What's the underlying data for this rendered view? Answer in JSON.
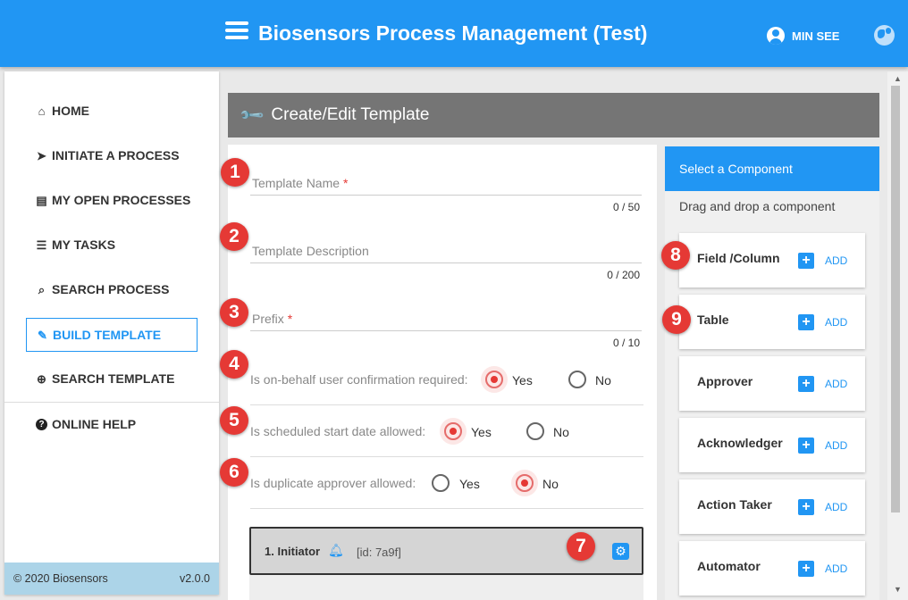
{
  "header": {
    "title": "Biosensors Process Management (Test)",
    "user": "MIN SEE",
    "colors": {
      "bar": "#2196f3"
    }
  },
  "sidebar": {
    "items": [
      {
        "label": "HOME",
        "icon": "home-icon",
        "glyph": "⌂"
      },
      {
        "label": "INITIATE A PROCESS",
        "icon": "chevron-icon",
        "glyph": "➤"
      },
      {
        "label": "MY OPEN PROCESSES",
        "icon": "document-icon",
        "glyph": "▤"
      },
      {
        "label": "MY TASKS",
        "icon": "list-icon",
        "glyph": "☰"
      },
      {
        "label": "SEARCH PROCESS",
        "icon": "search-icon",
        "glyph": "⌕"
      },
      {
        "label": "BUILD TEMPLATE",
        "icon": "wrench-icon",
        "glyph": "🔧",
        "active": true
      },
      {
        "label": "SEARCH TEMPLATE",
        "icon": "zoom-icon",
        "glyph": "⊕"
      },
      {
        "label": "ONLINE HELP",
        "icon": "help-icon",
        "glyph": "?"
      }
    ],
    "footer": {
      "copyright": "© 2020 Biosensors",
      "version": "v2.0.0"
    }
  },
  "main": {
    "title": "Create/Edit Template",
    "fields": [
      {
        "placeholder": "Template Name",
        "required": "*",
        "counter": "0 / 50"
      },
      {
        "placeholder": "Template Description",
        "required": "",
        "counter": "0 / 200"
      },
      {
        "placeholder": "Prefix",
        "required": "*",
        "counter": "0 / 10"
      }
    ],
    "questions": [
      {
        "label": "Is on-behalf user confirmation required:",
        "yes": "Yes",
        "no": "No",
        "selected": "yes"
      },
      {
        "label": "Is scheduled start date allowed:",
        "yes": "Yes",
        "no": "No",
        "selected": "yes"
      },
      {
        "label": "Is duplicate approver allowed:",
        "yes": "Yes",
        "no": "No",
        "selected": "no"
      }
    ],
    "initiator": {
      "title": "1. Initiator",
      "id": "[id: 7a9f]"
    },
    "badges": [
      "1",
      "2",
      "3",
      "4",
      "5",
      "6",
      "7",
      "8",
      "9"
    ]
  },
  "components": {
    "title": "Select a Component",
    "subtitle": "Drag and drop a component",
    "add_label": "ADD",
    "items": [
      "Field /Column",
      "Table",
      "Approver",
      "Acknowledger",
      "Action Taker",
      "Automator"
    ]
  }
}
